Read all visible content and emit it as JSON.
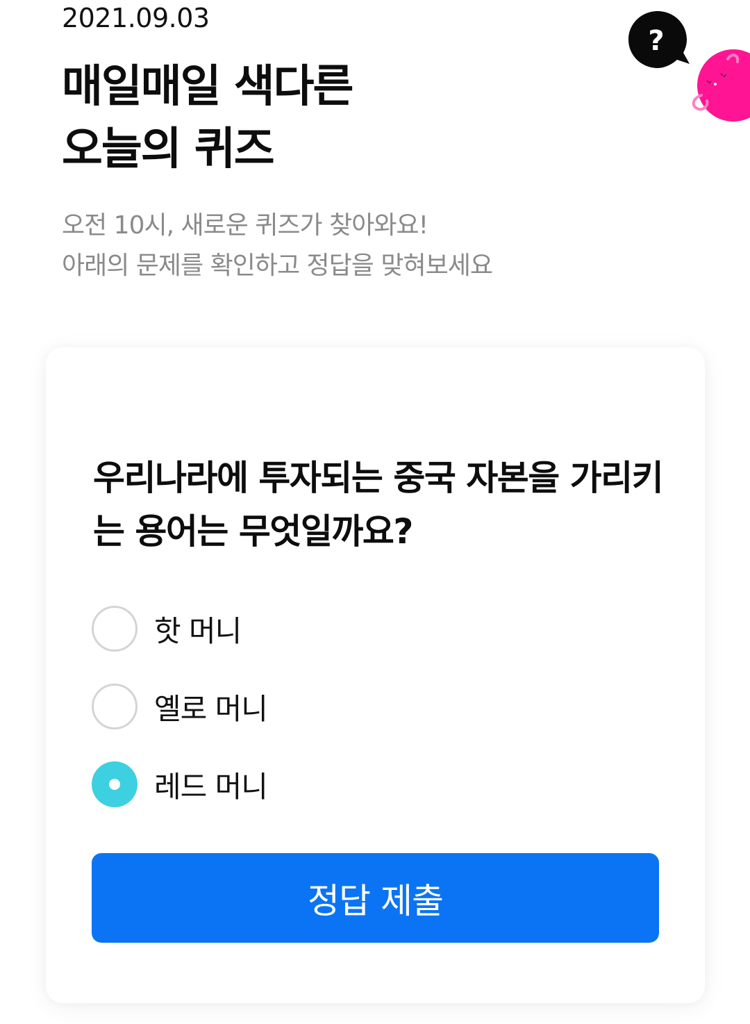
{
  "header": {
    "date": "2021.09.03",
    "title_line1": "매일매일 색다른",
    "title_line2": "오늘의 퀴즈",
    "subtitle_line1": "오전 10시, 새로운 퀴즈가 찾아와요!",
    "subtitle_line2": "아래의 문제를 확인하고 정답을 맞혀보세요",
    "help_icon_glyph": "?"
  },
  "quiz": {
    "question": "우리나라에 투자되는 중국 자본을 가리키는 용어는 무엇일까요?",
    "options": [
      {
        "label": "핫 머니",
        "selected": false
      },
      {
        "label": "옐로 머니",
        "selected": false
      },
      {
        "label": "레드 머니",
        "selected": true
      }
    ],
    "submit_label": "정답 제출"
  },
  "colors": {
    "accent_button": "#0b74f4",
    "selected_radio": "#3dd0e0",
    "mascot": "#ff1493"
  },
  "icons": [
    "help-icon",
    "mascot-icon"
  ]
}
